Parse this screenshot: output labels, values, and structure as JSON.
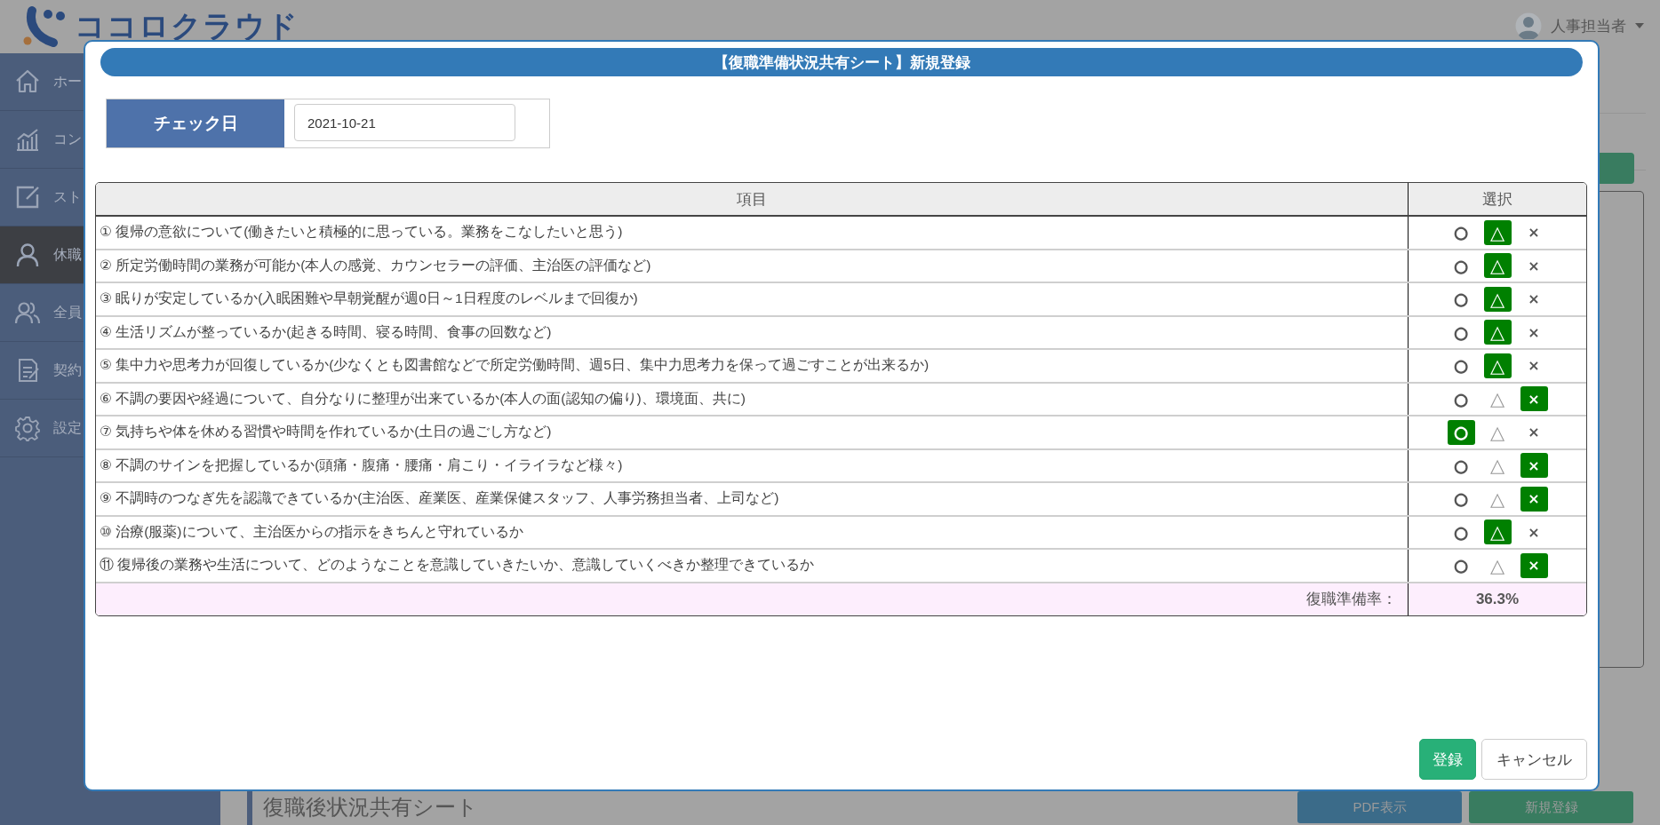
{
  "header": {
    "logo_text": "ココロクラウド",
    "user": "人事担当者"
  },
  "sidebar": {
    "items": [
      {
        "label": "ホー",
        "selected": false
      },
      {
        "label": "コン",
        "selected": false
      },
      {
        "label": "スト",
        "selected": false
      },
      {
        "label": "休職",
        "selected": true
      },
      {
        "label": "全員",
        "selected": false
      },
      {
        "label": "契約",
        "selected": false
      },
      {
        "label": "設定",
        "selected": false
      }
    ]
  },
  "background_page": {
    "section_title": "復職後状況共有シート",
    "buttons": [
      {
        "label": "PDF表示",
        "kind": "info"
      },
      {
        "label": "新規登録",
        "kind": "success"
      }
    ]
  },
  "dialog": {
    "title": "【復職準備状況共有シート】新規登録",
    "check_date": {
      "label": "チェック日",
      "value": "2021-10-21"
    },
    "table": {
      "columns": [
        "項目",
        "選択"
      ],
      "rows": [
        {
          "item": "① 復帰の意欲について(働きたいと積極的に思っている。業務をこなしたいと思う)",
          "choices": [
            {
              "kind": "circle",
              "label": "○",
              "selected": false
            },
            {
              "kind": "triangle",
              "label": "△",
              "selected": true
            },
            {
              "kind": "cross",
              "label": "×",
              "selected": false
            }
          ]
        },
        {
          "item": "② 所定労働時間の業務が可能か(本人の感覚、カウンセラーの評価、主治医の評価など)",
          "choices": [
            {
              "kind": "circle",
              "label": "○",
              "selected": false
            },
            {
              "kind": "triangle",
              "label": "△",
              "selected": true
            },
            {
              "kind": "cross",
              "label": "×",
              "selected": false
            }
          ]
        },
        {
          "item": "③ 眠りが安定しているか(入眠困難や早朝覚醒が週0日～1日程度のレベルまで回復か)",
          "choices": [
            {
              "kind": "circle",
              "label": "○",
              "selected": false
            },
            {
              "kind": "triangle",
              "label": "△",
              "selected": true
            },
            {
              "kind": "cross",
              "label": "×",
              "selected": false
            }
          ]
        },
        {
          "item": "④ 生活リズムが整っているか(起きる時間、寝る時間、食事の回数など)",
          "choices": [
            {
              "kind": "circle",
              "label": "○",
              "selected": false
            },
            {
              "kind": "triangle",
              "label": "△",
              "selected": true
            },
            {
              "kind": "cross",
              "label": "×",
              "selected": false
            }
          ]
        },
        {
          "item": "⑤ 集中力や思考力が回復しているか(少なくとも図書館などで所定労働時間、週5日、集中力思考力を保って過ごすことが出来るか)",
          "choices": [
            {
              "kind": "circle",
              "label": "○",
              "selected": false
            },
            {
              "kind": "triangle",
              "label": "△",
              "selected": true
            },
            {
              "kind": "cross",
              "label": "×",
              "selected": false
            }
          ]
        },
        {
          "item": "⑥ 不調の要因や経過について、自分なりに整理が出来ているか(本人の面(認知の偏り)、環境面、共に)",
          "choices": [
            {
              "kind": "circle",
              "label": "○",
              "selected": false
            },
            {
              "kind": "triangle",
              "label": "△",
              "selected": false
            },
            {
              "kind": "cross",
              "label": "×",
              "selected": true
            }
          ]
        },
        {
          "item": "⑦ 気持ちや体を休める習慣や時間を作れているか(土日の過ごし方など)",
          "choices": [
            {
              "kind": "circle",
              "label": "○",
              "selected": true
            },
            {
              "kind": "triangle",
              "label": "△",
              "selected": false
            },
            {
              "kind": "cross",
              "label": "×",
              "selected": false
            }
          ]
        },
        {
          "item": "⑧ 不調のサインを把握しているか(頭痛・腹痛・腰痛・肩こり・イライラなど様々)",
          "choices": [
            {
              "kind": "circle",
              "label": "○",
              "selected": false
            },
            {
              "kind": "triangle",
              "label": "△",
              "selected": false
            },
            {
              "kind": "cross",
              "label": "×",
              "selected": true
            }
          ]
        },
        {
          "item": "⑨ 不調時のつなぎ先を認識できているか(主治医、産業医、産業保健スタッフ、人事労務担当者、上司など)",
          "choices": [
            {
              "kind": "circle",
              "label": "○",
              "selected": false
            },
            {
              "kind": "triangle",
              "label": "△",
              "selected": false
            },
            {
              "kind": "cross",
              "label": "×",
              "selected": true
            }
          ]
        },
        {
          "item": "⑩ 治療(服薬)について、主治医からの指示をきちんと守れているか",
          "choices": [
            {
              "kind": "circle",
              "label": "○",
              "selected": false
            },
            {
              "kind": "triangle",
              "label": "△",
              "selected": true
            },
            {
              "kind": "cross",
              "label": "×",
              "selected": false
            }
          ]
        },
        {
          "item": "⑪ 復帰後の業務や生活について、どのようなことを意識していきたいか、意識していくべきか整理できているか",
          "choices": [
            {
              "kind": "circle",
              "label": "○",
              "selected": false
            },
            {
              "kind": "triangle",
              "label": "△",
              "selected": false
            },
            {
              "kind": "cross",
              "label": "×",
              "selected": true
            }
          ]
        }
      ],
      "footer": {
        "label": "復職準備率：",
        "value": "36.3%"
      }
    },
    "buttons": [
      {
        "label": "登録",
        "kind": "primary"
      },
      {
        "label": "キャンセル",
        "kind": "default"
      }
    ]
  }
}
